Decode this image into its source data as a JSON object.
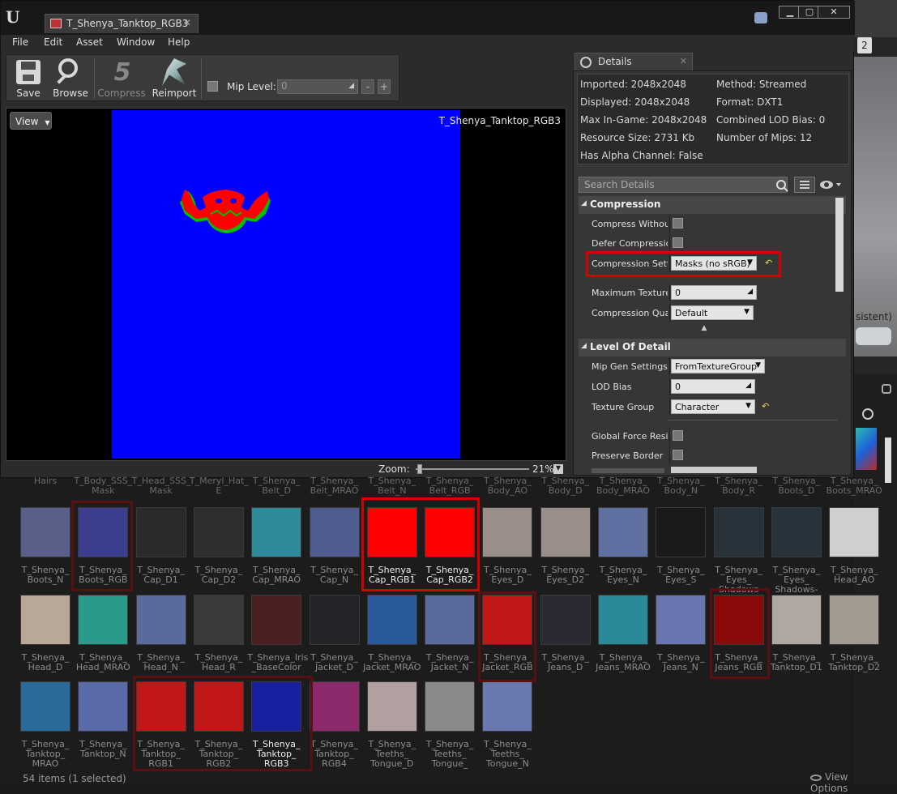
{
  "window": {
    "doc_tab": "T_Shenya_Tanktop_RGB3"
  },
  "menu": [
    "File",
    "Edit",
    "Asset",
    "Window",
    "Help"
  ],
  "toolbar": {
    "save": "Save",
    "browse": "Browse",
    "compress": "Compress",
    "reimport": "Reimport",
    "mip_level_label": "Mip Level:",
    "mip_level_value": "0",
    "minus": "-",
    "plus": "+"
  },
  "viewport": {
    "view_button": "View",
    "texture_title": "T_Shenya_Tanktop_RGB3",
    "texture_color": "#0000ff",
    "zoom_label": "Zoom:",
    "zoom_value": "21%"
  },
  "details": {
    "tab": "Details",
    "info": {
      "imported": "Imported: 2048x2048",
      "displayed": "Displayed: 2048x2048",
      "max_ingame": "Max In-Game: 2048x2048",
      "resource_size": "Resource Size: 2731 Kb",
      "has_alpha": "Has Alpha Channel: False",
      "method": "Method: Streamed",
      "format": "Format: DXT1",
      "combined_lod": "Combined LOD Bias: 0",
      "num_mips": "Number of Mips: 12"
    },
    "search_placeholder": "Search Details",
    "compression": {
      "header": "Compression",
      "compress_without": "Compress Without",
      "defer_compression": "Defer Compression",
      "compression_settings": "Compression Setti",
      "compression_settings_value": "Masks (no sRGB)",
      "max_texture": "Maximum Texture",
      "max_texture_value": "0",
      "compression_quality": "Compression Quali",
      "compression_quality_value": "Default"
    },
    "lod": {
      "header": "Level Of Detail",
      "mip_gen": "Mip Gen Settings",
      "mip_gen_value": "FromTextureGroup",
      "lod_bias": "LOD Bias",
      "lod_bias_value": "0",
      "texture_group": "Texture Group",
      "texture_group_value": "Character",
      "global_force": "Global Force Resid",
      "preserve_border": "Preserve Border"
    }
  },
  "content_browser": {
    "top_row": [
      "Hairs",
      "T_Body_SSS_\nMask",
      "T_Head_SSS_\nMask",
      "T_Meryl_Hat_\nE",
      "T_Shenya_\nBelt_D",
      "T_Shenya_\nBelt_MRAO",
      "T_Shenya_\nBelt_N",
      "T_Shenya_\nBelt_RGB",
      "T_Shenya_\nBody_AO",
      "T_Shenya_\nBody_D",
      "T_Shenya_\nBody_MRAO",
      "T_Shenya_\nBody_N",
      "T_Shenya_\nBody_R",
      "T_Shenya_\nBoots_D",
      "T_Shenya_\nBoots_MRAO"
    ],
    "row1": [
      "T_Shenya_\nBoots_N",
      "T_Shenya_\nBoots_RGB",
      "T_Shenya_\nCap_D1",
      "T_Shenya_\nCap_D2",
      "T_Shenya_\nCap_MRAO",
      "T_Shenya_\nCap_N",
      "T_Shenya_\nCap_RGB1",
      "T_Shenya_\nCap_RGB2",
      "T_Shenya_\nEyes_D",
      "T_Shenya_\nEyes_D2",
      "T_Shenya_\nEyes_N",
      "T_Shenya_\nEyes_S",
      "T_Shenya_\nEyes_\nShadows",
      "T_Shenya_\nEyes_\nShadows-",
      "T_Shenya_\nHead_AO"
    ],
    "row2": [
      "T_Shenya_\nHead_D",
      "T_Shenya_\nHead_MRAO",
      "T_Shenya_\nHead_N",
      "T_Shenya_\nHead_R",
      "T_Shenya_Iris\n_BaseColor",
      "T_Shenya_\nJacket_D",
      "T_Shenya_\nJacket_MRAO",
      "T_Shenya_\nJacket_N",
      "T_Shenya_\nJacket_RGB",
      "T_Shenya_\nJeans_D",
      "T_Shenya_\nJeans_MRAO",
      "T_Shenya_\nJeans_N",
      "T_Shenya_\nJeans_RGB",
      "T_Shenya_\nTanktop_D1",
      "T_Shenya_\nTanktop_D2"
    ],
    "row3": [
      "T_Shenya_\nTanktop_\nMRAO",
      "T_Shenya_\nTanktop_N",
      "T_Shenya_\nTanktop_\nRGB1",
      "T_Shenya_\nTanktop_\nRGB2",
      "T_Shenya_\nTanktop_\nRGB3",
      "T_Shenya_\nTanktop_\nRGB4",
      "T_Shenya_\nTeeths_\nTongue_D",
      "T_Shenya_\nTeeths_\nTongue_",
      "T_Shenya_\nTeeths_\nTongue_N"
    ],
    "status": "54 items (1 selected)",
    "view_options": "View Options"
  },
  "background": {
    "persistent_fragment": "sistent)"
  }
}
